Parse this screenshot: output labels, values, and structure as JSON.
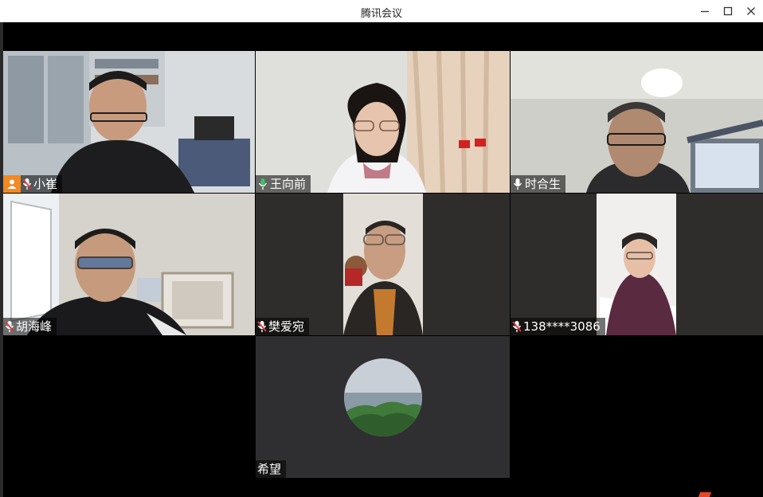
{
  "window": {
    "title": "腾讯会议",
    "controls": [
      "minimize-icon",
      "maximize-icon",
      "close-icon"
    ]
  },
  "participants": [
    {
      "name": "小崔",
      "is_host": true,
      "mic": "muted",
      "active": false
    },
    {
      "name": "王向前",
      "is_host": false,
      "mic": "speaking",
      "active": true
    },
    {
      "name": "时合生",
      "is_host": false,
      "mic": "on",
      "active": false
    },
    {
      "name": "胡海峰",
      "is_host": false,
      "mic": "muted",
      "active": false
    },
    {
      "name": "樊爱宛",
      "is_host": false,
      "mic": "muted",
      "active": false
    },
    {
      "name": "138****3086",
      "is_host": false,
      "mic": "muted",
      "active": false
    },
    {
      "name": "希望",
      "is_host": false,
      "mic": "none",
      "active": false,
      "video": "avatar"
    }
  ],
  "colors": {
    "active_border": "#3cc26a",
    "host_badge": "#f08a24",
    "mic_muted": "#e03a3a",
    "mic_speaking": "#3cc26a",
    "tile_background": "#2f2d2c"
  }
}
